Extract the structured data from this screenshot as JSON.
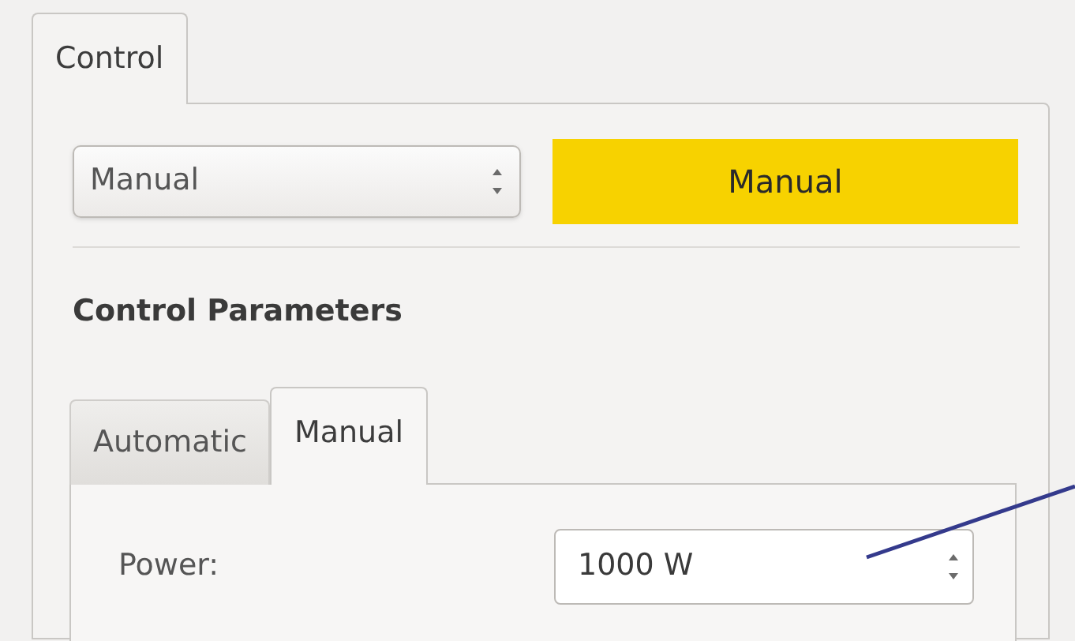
{
  "tabs": [
    {
      "label": "Control",
      "selected": true
    }
  ],
  "mode_select": {
    "value": "Manual"
  },
  "mode_indicator": {
    "text": "Manual",
    "color": "#f7d200"
  },
  "section_title": "Control Parameters",
  "parameter_tabs": [
    {
      "label": "Automatic",
      "selected": false
    },
    {
      "label": "Manual",
      "selected": true
    }
  ],
  "fields": [
    {
      "label": "Power:",
      "value": "1000 W"
    }
  ]
}
